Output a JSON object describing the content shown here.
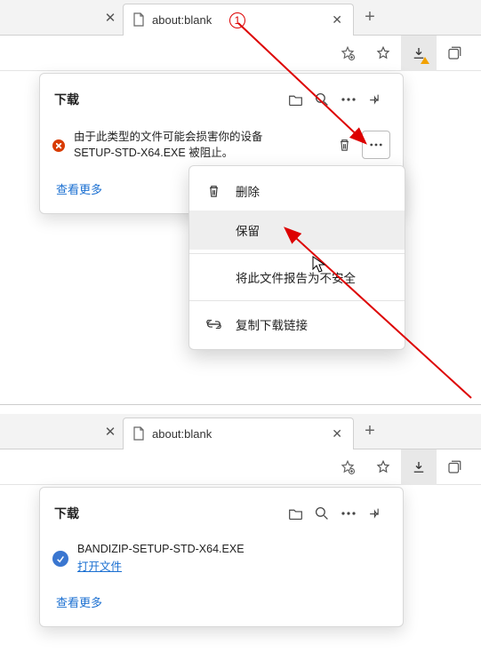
{
  "annot": {
    "num": "1"
  },
  "top": {
    "tab_title": "about:blank",
    "downloads": {
      "title": "下载",
      "blocked_msg_l1": "由于此类型的文件可能会损害你的设备",
      "blocked_msg_l2": "SETUP-STD-X64.EXE 被阻止。",
      "see_more": "查看更多"
    },
    "ctx": {
      "delete": "删除",
      "keep": "保留",
      "report": "将此文件报告为不安全",
      "copy_link": "复制下载链接"
    }
  },
  "bottom": {
    "tab_title": "about:blank",
    "downloads": {
      "title": "下载",
      "file_name": "BANDIZIP-SETUP-STD-X64.EXE",
      "open_file": "打开文件",
      "see_more": "查看更多"
    }
  }
}
